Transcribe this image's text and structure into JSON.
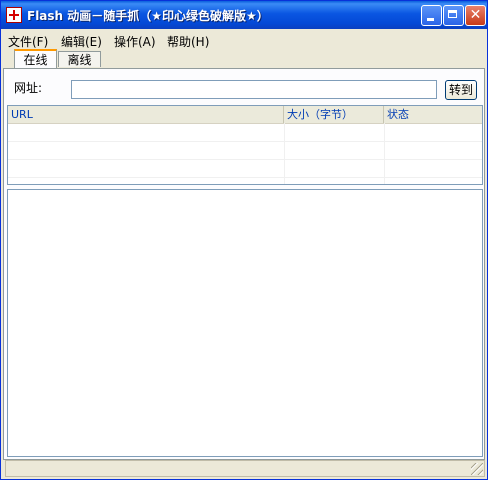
{
  "window": {
    "title": "Flash 动画－随手抓（★印心绿色破解版★）"
  },
  "titlebar": {
    "close_glyph": "✕"
  },
  "menu": [
    "文件(F)",
    "编辑(E)",
    "操作(A)",
    "帮助(H)"
  ],
  "tabs": [
    "在线",
    "离线"
  ],
  "address": {
    "label": "网址:",
    "value": "",
    "go_label": "转到"
  },
  "list": {
    "columns": [
      "URL",
      "大小（字节）",
      "状态"
    ],
    "rows": []
  },
  "colors": {
    "titlebar": "#0a56e2",
    "header_text": "#003cb4",
    "tab_highlight": "#ff9900"
  }
}
